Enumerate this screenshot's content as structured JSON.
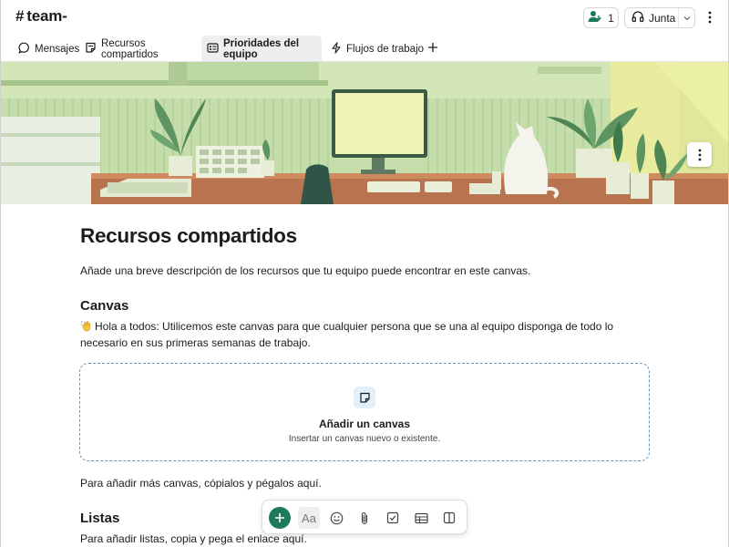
{
  "header": {
    "channel_hash": "#",
    "channel_name": "team-",
    "members_count": "1",
    "huddle_label": "Junta"
  },
  "tabs": [
    {
      "label": "Mensajes",
      "icon": "message-bubble-icon"
    },
    {
      "label": "Recursos compartidos",
      "icon": "canvas-doc-icon",
      "active": true
    },
    {
      "label": "Prioridades del equipo",
      "icon": "list-card-icon",
      "hovered": true
    },
    {
      "label": "Flujos de trabajo",
      "icon": "lightning-icon"
    }
  ],
  "page": {
    "title": "Recursos compartidos",
    "description": "Añade una breve descripción de los recursos que tu equipo puede encontrar en este canvas.",
    "canvas_heading": "Canvas",
    "canvas_text": "Hola a todos: Utilicemos este canvas para que cualquier persona que se una al equipo disponga de todo lo necesario en sus primeras semanas de trabajo.",
    "drop_zone": {
      "title": "Añadir un canvas",
      "subtitle": "Insertar un canvas nuevo o existente."
    },
    "copy_hint": "Para añadir más canvas, cópialos y pégalos aquí.",
    "listas_heading": "Listas",
    "listas_text": "Para añadir listas, copia y pega el enlace aquí."
  },
  "toolbar": {
    "format_label": "Aa",
    "items": [
      "add-icon",
      "text-format-icon",
      "emoji-icon",
      "paperclip-icon",
      "checklist-icon",
      "table-icon",
      "columns-icon"
    ]
  },
  "colors": {
    "accent_tab": "#6b3a8f",
    "add_button": "#1f7a5b",
    "dashed_border": "#6a93c3",
    "banner_green": "#cfe3b0"
  }
}
